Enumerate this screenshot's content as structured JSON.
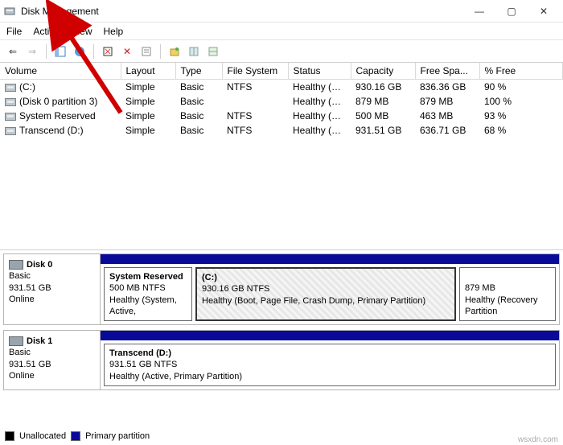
{
  "window": {
    "title": "Disk Management"
  },
  "winbtns": {
    "min": "—",
    "max": "▢",
    "close": "✕"
  },
  "menu": {
    "file": "File",
    "action": "Action",
    "view": "View",
    "help": "Help"
  },
  "columns": {
    "volume": "Volume",
    "layout": "Layout",
    "type": "Type",
    "fs": "File System",
    "status": "Status",
    "capacity": "Capacity",
    "free": "Free Spa...",
    "pct": "% Free"
  },
  "rows": {
    "0": {
      "vol": "(C:)",
      "layout": "Simple",
      "type": "Basic",
      "fs": "NTFS",
      "status": "Healthy (B...",
      "cap": "930.16 GB",
      "free": "836.36 GB",
      "pct": "90 %"
    },
    "1": {
      "vol": "(Disk 0 partition 3)",
      "layout": "Simple",
      "type": "Basic",
      "fs": "",
      "status": "Healthy (R...",
      "cap": "879 MB",
      "free": "879 MB",
      "pct": "100 %"
    },
    "2": {
      "vol": "System Reserved",
      "layout": "Simple",
      "type": "Basic",
      "fs": "NTFS",
      "status": "Healthy (S...",
      "cap": "500 MB",
      "free": "463 MB",
      "pct": "93 %"
    },
    "3": {
      "vol": "Transcend (D:)",
      "layout": "Simple",
      "type": "Basic",
      "fs": "NTFS",
      "status": "Healthy (A...",
      "cap": "931.51 GB",
      "free": "636.71 GB",
      "pct": "68 %"
    }
  },
  "disk0": {
    "label": "Disk 0",
    "type": "Basic",
    "size": "931.51 GB",
    "state": "Online",
    "p0": {
      "name": "System Reserved",
      "size": "500 MB NTFS",
      "status": "Healthy (System, Active,"
    },
    "p1": {
      "name": "(C:)",
      "size": "930.16 GB NTFS",
      "status": "Healthy (Boot, Page File, Crash Dump, Primary Partition)"
    },
    "p2": {
      "name": "",
      "size": "879 MB",
      "status": "Healthy (Recovery Partition"
    }
  },
  "disk1": {
    "label": "Disk 1",
    "type": "Basic",
    "size": "931.51 GB",
    "state": "Online",
    "p0": {
      "name": "Transcend (D:)",
      "size": "931.51 GB NTFS",
      "status": "Healthy (Active, Primary Partition)"
    }
  },
  "legend": {
    "unalloc": "Unallocated",
    "primary": "Primary partition"
  },
  "watermark": "wsxdn.com"
}
